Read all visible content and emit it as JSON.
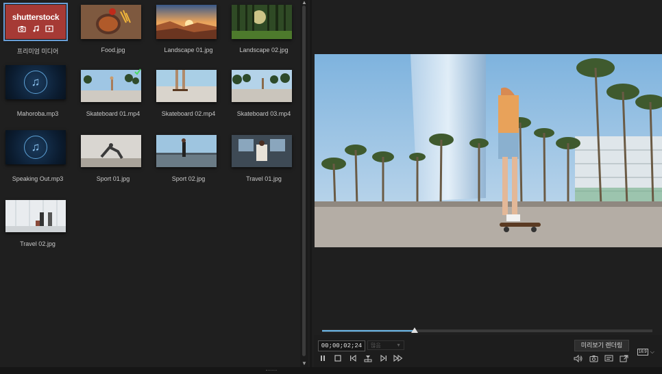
{
  "library": {
    "items": [
      {
        "label": "프리미엄 미디어",
        "type": "shutterstock",
        "logo_text": "shutterstock"
      },
      {
        "label": "Food.jpg",
        "type": "image"
      },
      {
        "label": "Landscape 01.jpg",
        "type": "image"
      },
      {
        "label": "Landscape 02.jpg",
        "type": "image"
      },
      {
        "label": "Mahoroba.mp3",
        "type": "audio"
      },
      {
        "label": "Skateboard 01.mp4",
        "type": "video",
        "used": true
      },
      {
        "label": "Skateboard 02.mp4",
        "type": "video"
      },
      {
        "label": "Skateboard 03.mp4",
        "type": "video"
      },
      {
        "label": "Speaking Out.mp3",
        "type": "audio"
      },
      {
        "label": "Sport 01.jpg",
        "type": "image"
      },
      {
        "label": "Sport 02.jpg",
        "type": "image"
      },
      {
        "label": "Travel 01.jpg",
        "type": "image"
      },
      {
        "label": "Travel 02.jpg",
        "type": "image"
      }
    ]
  },
  "player": {
    "timecode": "00;00;02;24",
    "quality": "많음",
    "render_label": "미리보기 렌더링",
    "aspect": "16:9",
    "progress": 0.28
  },
  "colors": {
    "accent": "#69b7e8",
    "selection": "#6a9fd6",
    "shutterstock": "#a63a35"
  }
}
